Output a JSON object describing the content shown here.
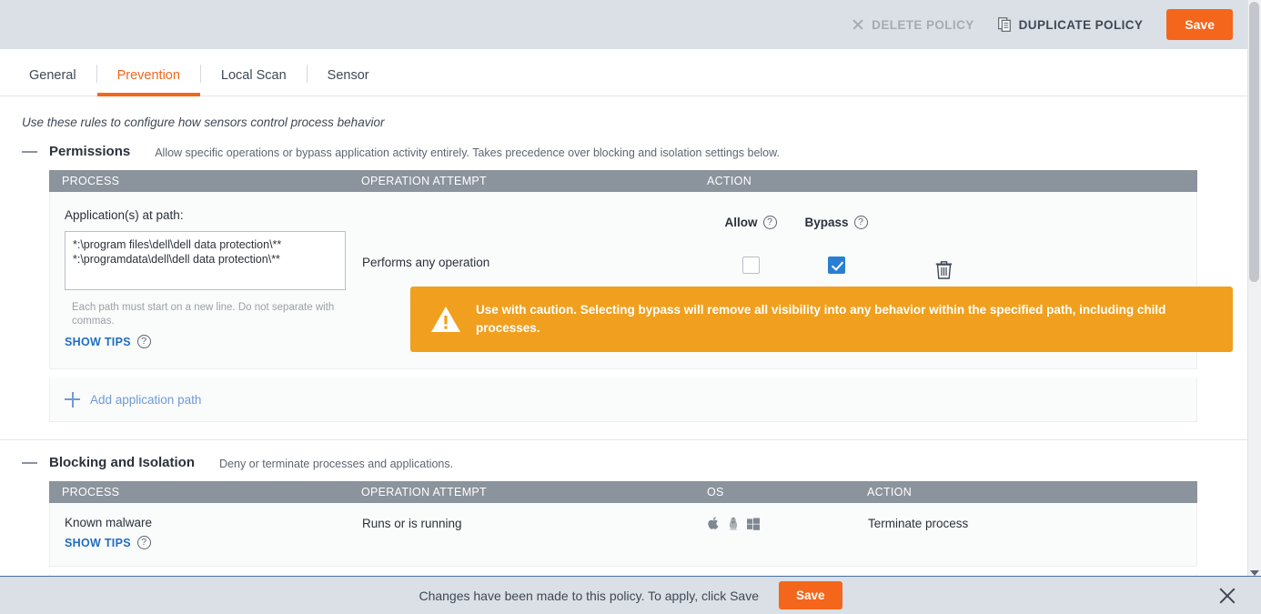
{
  "topbar": {
    "delete_policy": "DELETE POLICY",
    "duplicate_policy": "DUPLICATE POLICY",
    "save": "Save"
  },
  "tabs": [
    {
      "label": "General",
      "active": false
    },
    {
      "label": "Prevention",
      "active": true
    },
    {
      "label": "Local Scan",
      "active": false
    },
    {
      "label": "Sensor",
      "active": false
    }
  ],
  "intro": "Use these rules to configure how sensors control process behavior",
  "permissions": {
    "title": "Permissions",
    "description": "Allow specific operations or bypass application activity entirely. Takes precedence over blocking and isolation settings below.",
    "columns": {
      "process": "PROCESS",
      "operation": "OPERATION ATTEMPT",
      "action": "ACTION"
    },
    "row": {
      "path_label": "Application(s) at path:",
      "paths": "*:\\program files\\dell\\dell data protection\\**\n*:\\programdata\\dell\\dell data protection\\**",
      "hint": "Each path must start on a new line. Do not separate with commas.",
      "show_tips": "SHOW TIPS",
      "operation": "Performs any operation",
      "allow_label": "Allow",
      "allow_checked": false,
      "bypass_label": "Bypass",
      "bypass_checked": true,
      "warning": "Use with caution. Selecting bypass will remove all visibility into any behavior within the specified path, including child processes."
    },
    "add_path": "Add application path"
  },
  "blocking": {
    "title": "Blocking and Isolation",
    "description": "Deny or terminate processes and applications.",
    "columns": {
      "process": "PROCESS",
      "operation": "OPERATION ATTEMPT",
      "os": "OS",
      "action": "ACTION"
    },
    "rows": [
      {
        "process": "Known malware",
        "show_tips": "SHOW TIPS",
        "operation": "Runs or is running",
        "os": [
          "apple-icon",
          "linux-icon",
          "windows-icon"
        ],
        "action": "Terminate process"
      }
    ]
  },
  "notification": {
    "message": "Changes have been made to this policy. To apply, click Save",
    "save": "Save"
  },
  "colors": {
    "accent_orange": "#f4661b",
    "warning_orange": "#f0a01e",
    "checkbox_blue": "#2a7fd4",
    "link_blue": "#1f6ec2",
    "header_gray": "#8b939c",
    "chrome_gray": "#dbe0e6"
  }
}
